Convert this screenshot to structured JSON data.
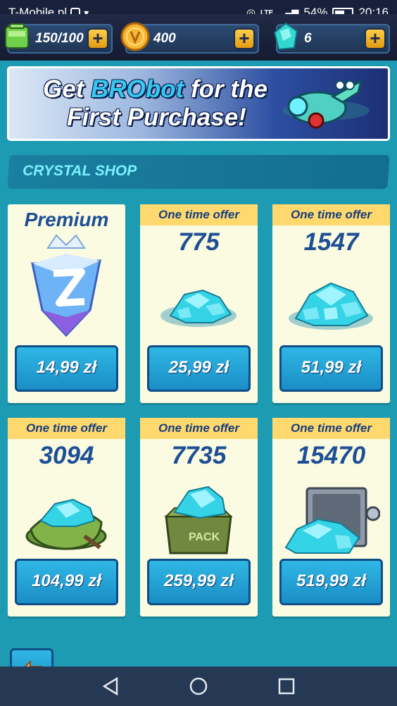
{
  "status_bar": {
    "carrier": "T-Mobile.pl",
    "network": "LTE",
    "battery": "54%",
    "time": "20:16"
  },
  "resources": {
    "energy": "150/100",
    "coins": "400",
    "crystals": "6"
  },
  "banner": {
    "line1_prefix": "Get",
    "line1_highlight": "BRObot",
    "line1_suffix": "for the",
    "line2": "First Purchase!"
  },
  "section_title": "CRYSTAL SHOP",
  "offers": [
    {
      "label": "Premium",
      "price": "14,99 zł"
    },
    {
      "label": "One time offer",
      "amount": "775",
      "price": "25,99 zł"
    },
    {
      "label": "One time offer",
      "amount": "1547",
      "price": "51,99 zł"
    },
    {
      "label": "One time offer",
      "amount": "3094",
      "price": "104,99 zł"
    },
    {
      "label": "One time offer",
      "amount": "7735",
      "price": "259,99 zł"
    },
    {
      "label": "One time offer",
      "amount": "15470",
      "price": "519,99 zł"
    }
  ],
  "colors": {
    "background": "#1d9bb3",
    "card": "#fbfbe1",
    "offer_header": "#ffd86e",
    "amount_text": "#1d4f96",
    "price_button": "#1a8ec6"
  },
  "icons": {
    "energy": "energy-battery-icon",
    "coin": "coin-icon",
    "crystal": "crystal-icon",
    "plus": "plus-icon",
    "back": "back-arrow-icon"
  }
}
